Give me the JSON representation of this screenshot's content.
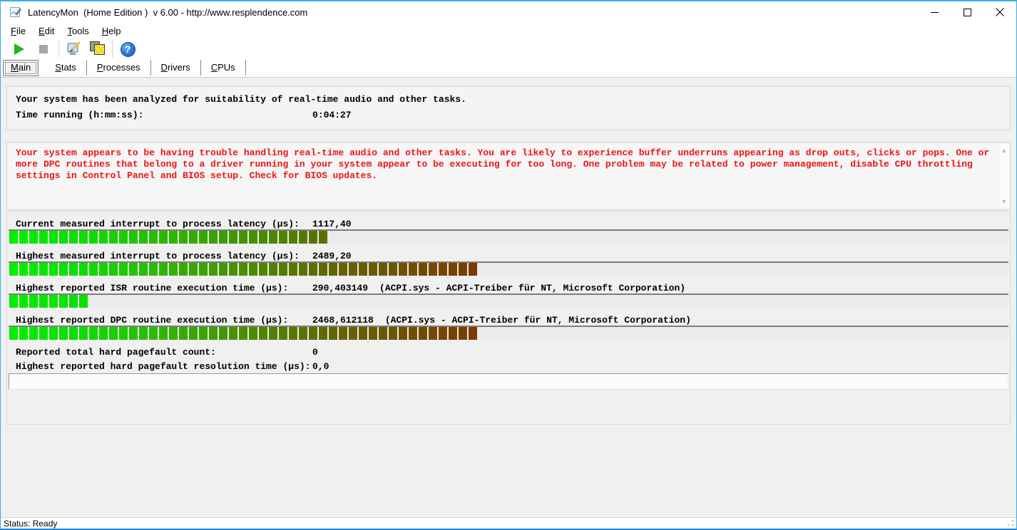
{
  "window": {
    "title": "LatencyMon  (Home Edition )  v 6.00 - http://www.resplendence.com",
    "controls": [
      "minimize",
      "maximize",
      "close"
    ]
  },
  "menu": {
    "items": [
      {
        "label": "File"
      },
      {
        "label": "Edit"
      },
      {
        "label": "Tools"
      },
      {
        "label": "Help"
      }
    ]
  },
  "toolbar": {
    "buttons": [
      {
        "name": "start-monitor",
        "icon": "play-icon"
      },
      {
        "name": "stop-monitor",
        "icon": "stop-icon",
        "disabled": true
      },
      {
        "name": "options",
        "icon": "tools-icon"
      },
      {
        "name": "copy-report",
        "icon": "copy-icon"
      },
      {
        "name": "help",
        "icon": "help-icon"
      }
    ],
    "help_glyph": "?"
  },
  "tabs": [
    {
      "label": "Main",
      "active": true
    },
    {
      "label": "Stats",
      "active": false
    },
    {
      "label": "Processes",
      "active": false
    },
    {
      "label": "Drivers",
      "active": false
    },
    {
      "label": "CPUs",
      "active": false
    }
  ],
  "summary": {
    "line1": "Your system has been analyzed for suitability of real-time audio and other tasks.",
    "time_label": "Time running (h:mm:ss):",
    "time_value": "0:04:27"
  },
  "warning": {
    "text": "Your system appears to be having trouble handling real-time audio and other tasks. You are likely to experience buffer underruns appearing as drop outs, clicks or pops. One or more DPC routines that belong to a driver running in your system appear to be executing for too long. One problem may be related to power management, disable CPU throttling settings in Control Panel and BIOS setup. Check for BIOS updates.",
    "text_color": "#ee1414"
  },
  "measurements": [
    {
      "label": "Current measured interrupt to process latency (µs):",
      "value": "1117,40",
      "detail": "",
      "fill": 0.32,
      "stops": [
        "#00f000",
        "#0fdc00",
        "#2bb800",
        "#459200",
        "#5a7000"
      ]
    },
    {
      "label": "Highest measured interrupt to process latency (µs):",
      "value": "2489,20",
      "detail": "",
      "fill": 0.479,
      "stops": [
        "#00f000",
        "#0edc00",
        "#2eb600",
        "#4b8e00",
        "#5f6a00",
        "#6f5200",
        "#7b3a00"
      ]
    },
    {
      "label": "Highest reported ISR routine execution time (µs):",
      "value": "290,403149",
      "detail": "(ACPI.sys - ACPI-Treiber für NT, Microsoft Corporation)",
      "fill": 0.08,
      "stops": [
        "#00ee00",
        "#04e800",
        "#09e000"
      ]
    },
    {
      "label": "Highest reported DPC routine execution time (µs):",
      "value": "2468,612118",
      "detail": "(ACPI.sys - ACPI-Treiber für NT, Microsoft Corporation)",
      "fill": 0.479,
      "stops": [
        "#00f000",
        "#0edc00",
        "#2eb600",
        "#4b8e00",
        "#5f6a00",
        "#6f5200",
        "#7b3a00"
      ]
    }
  ],
  "pagefaults": [
    {
      "label": "Reported total hard pagefault count:",
      "value": "0"
    },
    {
      "label": "Highest reported hard pagefault resolution time (µs):",
      "value": "0,0"
    }
  ],
  "status_bar": {
    "text": "Status: Ready"
  },
  "colors": {
    "accent_border": "#35aee8",
    "warning_text": "#ee1414",
    "bar_green": "#00f000",
    "bar_olive": "#5a7000",
    "bar_brown": "#7b3a00"
  }
}
